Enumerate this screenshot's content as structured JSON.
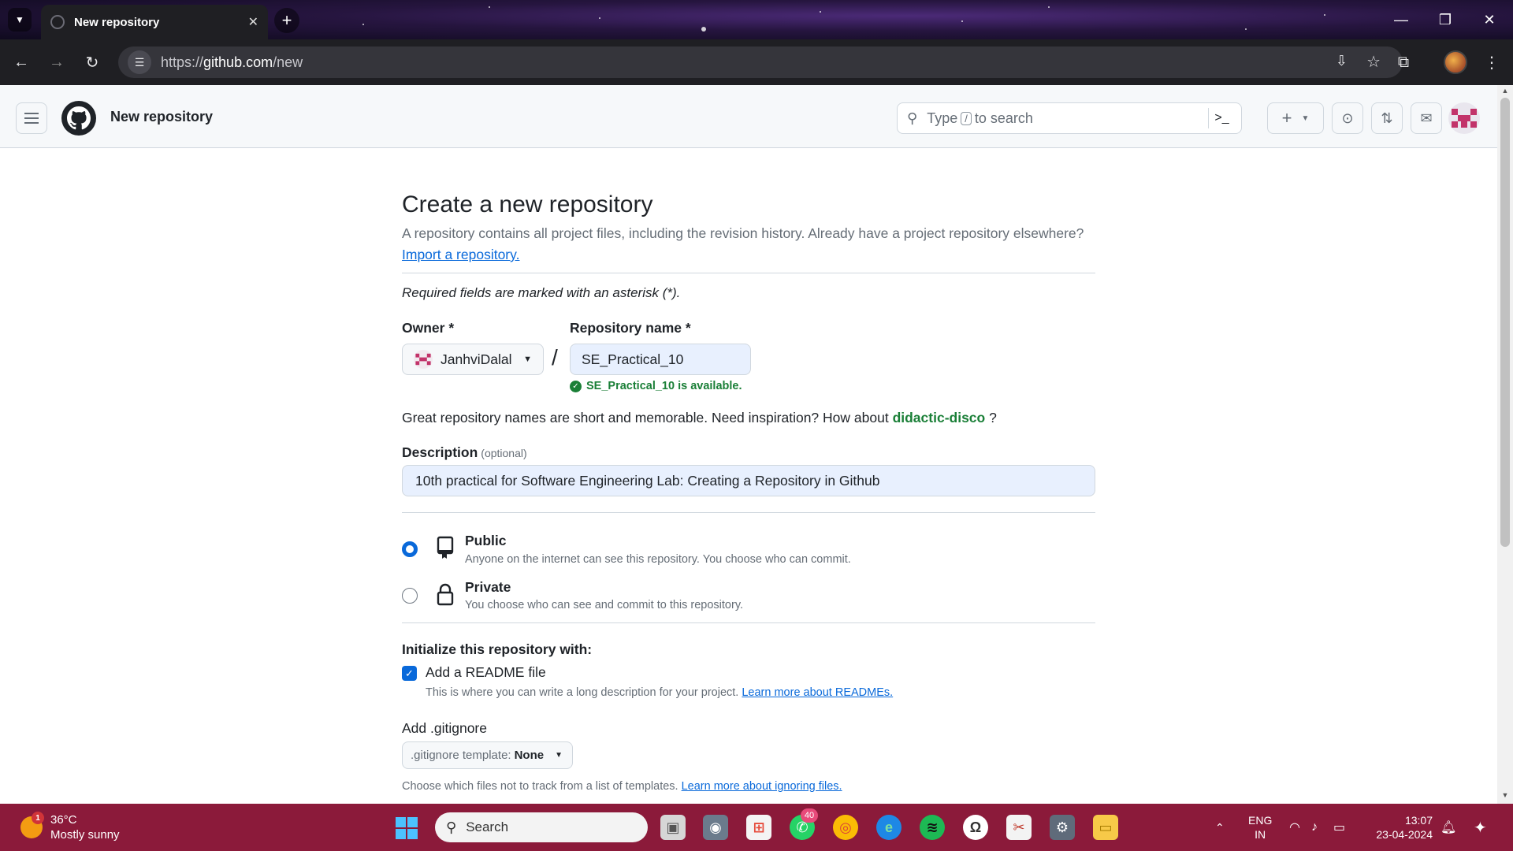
{
  "browser": {
    "tab_title": "New repository",
    "url_prefix": "https://",
    "url_host": "github.com",
    "url_path": "/new"
  },
  "header": {
    "title": "New repository",
    "search_pre": "Type",
    "search_key": "/",
    "search_post": "to search"
  },
  "form": {
    "title": "Create a new repository",
    "subtitle": "A repository contains all project files, including the revision history. Already have a project repository elsewhere?",
    "import_link": "Import a repository.",
    "required_note": "Required fields are marked with an asterisk (*).",
    "owner_label": "Owner *",
    "owner_value": "JanhviDalal",
    "repo_label": "Repository name *",
    "repo_value": "SE_Practical_10",
    "availability": "SE_Practical_10 is available.",
    "inspiration_text": "Great repository names are short and memorable. Need inspiration? How about",
    "inspiration_suggestion": "didactic-disco",
    "inspiration_end": "?",
    "description_label": "Description",
    "description_optional": "(optional)",
    "description_value": "10th practical for Software Engineering Lab: Creating a Repository in Github",
    "visibility": [
      {
        "title": "Public",
        "desc": "Anyone on the internet can see this repository. You choose who can commit.",
        "checked": true,
        "icon": "repo-icon"
      },
      {
        "title": "Private",
        "desc": "You choose who can see and commit to this repository.",
        "checked": false,
        "icon": "lock-icon"
      }
    ],
    "init_label": "Initialize this repository with:",
    "readme_label": "Add a README file",
    "readme_checked": true,
    "readme_desc": "This is where you can write a long description for your project.",
    "readme_link": "Learn more about READMEs.",
    "gitignore_label": "Add .gitignore",
    "gitignore_select_prefix": ".gitignore template:",
    "gitignore_select_value": "None",
    "gitignore_desc": "Choose which files not to track from a list of templates.",
    "gitignore_link": "Learn more about ignoring files."
  },
  "taskbar": {
    "weather_badge": "1",
    "weather_temp": "36°C",
    "weather_cond": "Mostly sunny",
    "search_placeholder": "Search",
    "whatsapp_badge": "40",
    "lang_top": "ENG",
    "lang_bottom": "IN",
    "time": "13:07",
    "date": "23-04-2024"
  },
  "colors": {
    "accent": "#0969da",
    "success": "#1a7f37",
    "taskbar": "#8b1a3a"
  }
}
